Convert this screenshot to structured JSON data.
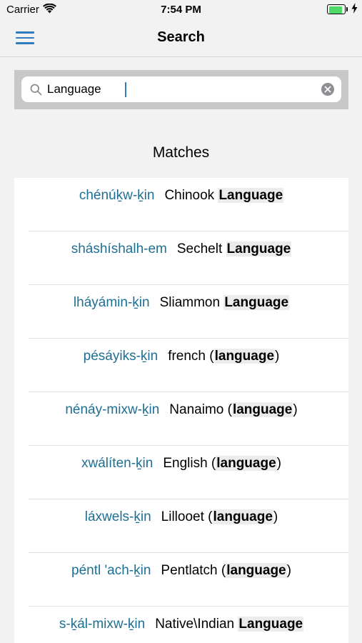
{
  "status_bar": {
    "carrier": "Carrier",
    "time": "7:54 PM",
    "battery_level": 0.9,
    "battery_color": "#4cd964"
  },
  "nav": {
    "title": "Search",
    "menu_icon": "hamburger-menu-icon",
    "accent_color": "#2f7bbd"
  },
  "search": {
    "value": "Language",
    "search_icon": "magnifier-icon",
    "clear_icon": "clear-circle-icon"
  },
  "section": {
    "title": "Matches"
  },
  "results": [
    {
      "native": "chénúḵw-ḵin",
      "pre": "Chinook ",
      "match": "Language",
      "post": ""
    },
    {
      "native": "sháshíshalh-em",
      "pre": "Sechelt ",
      "match": "Language",
      "post": ""
    },
    {
      "native": "lháyámin-ḵin",
      "pre": "Sliammon ",
      "match": "Language",
      "post": ""
    },
    {
      "native": "pésáyiks-ḵin",
      "pre": "french (",
      "match": "language",
      "post": ")"
    },
    {
      "native": "nénáy-mixw-ḵin",
      "pre": "Nanaimo (",
      "match": "language",
      "post": ")"
    },
    {
      "native": "xwálíten-ḵin",
      "pre": "English (",
      "match": "language",
      "post": ")"
    },
    {
      "native": "láxwels-ḵin",
      "pre": "Lillooet (",
      "match": "language",
      "post": ")"
    },
    {
      "native": "péntl 'ach-ḵin",
      "pre": "Pentlatch (",
      "match": "language",
      "post": ")"
    },
    {
      "native": "s-ḵál-mixw-ḵin",
      "pre": "Native\\Indian ",
      "match": "Language",
      "post": ""
    }
  ]
}
